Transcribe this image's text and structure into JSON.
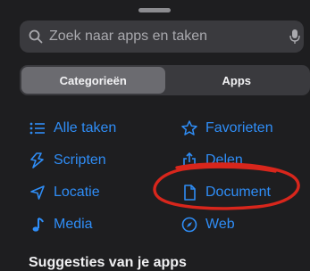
{
  "search": {
    "placeholder": "Zoek naar apps en taken",
    "icon": "search-icon",
    "mic_icon": "microphone-icon"
  },
  "tabs": [
    {
      "label": "Categorieën",
      "selected": true
    },
    {
      "label": "Apps",
      "selected": false
    }
  ],
  "categories": {
    "left": [
      {
        "label": "Alle taken",
        "icon": "list-icon"
      },
      {
        "label": "Scripten",
        "icon": "scripting-icon"
      },
      {
        "label": "Locatie",
        "icon": "location-arrow-icon"
      },
      {
        "label": "Media",
        "icon": "music-note-icon"
      }
    ],
    "right": [
      {
        "label": "Favorieten",
        "icon": "star-icon"
      },
      {
        "label": "Delen",
        "icon": "share-icon"
      },
      {
        "label": "Document",
        "icon": "document-icon"
      },
      {
        "label": "Web",
        "icon": "compass-icon"
      }
    ]
  },
  "suggestions": {
    "title": "Suggesties van je apps"
  },
  "colors": {
    "accent": "#2f8df6",
    "background": "#1e1e20",
    "annotation": "#d8261c"
  }
}
